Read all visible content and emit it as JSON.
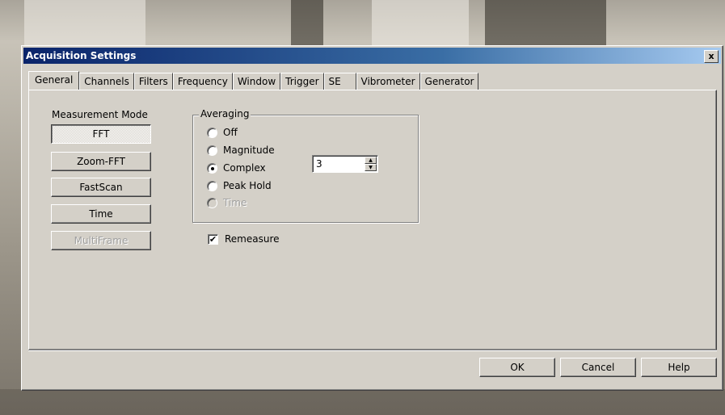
{
  "window": {
    "title": "Acquisition Settings",
    "close_label": "x"
  },
  "tabs": [
    {
      "label": "General",
      "active": true
    },
    {
      "label": "Channels"
    },
    {
      "label": "Filters"
    },
    {
      "label": "Frequency"
    },
    {
      "label": "Window"
    },
    {
      "label": "Trigger"
    },
    {
      "label": "SE"
    },
    {
      "label": "Vibrometer"
    },
    {
      "label": "Generator"
    }
  ],
  "measurement_mode": {
    "label": "Measurement Mode",
    "buttons": [
      {
        "label": "FFT",
        "state": "pressed"
      },
      {
        "label": "Zoom-FFT"
      },
      {
        "label": "FastScan"
      },
      {
        "label": "Time"
      },
      {
        "label": "MultiFrame",
        "state": "disabled"
      }
    ]
  },
  "averaging": {
    "title": "Averaging",
    "options": [
      {
        "label": "Off"
      },
      {
        "label": "Magnitude"
      },
      {
        "label": "Complex",
        "checked": true
      },
      {
        "label": "Peak Hold"
      },
      {
        "label": "Time",
        "disabled": true
      }
    ],
    "count": "3"
  },
  "remeasure": {
    "label": "Remeasure",
    "checked": true,
    "mark": "✔"
  },
  "footer": {
    "ok": "OK",
    "cancel": "Cancel",
    "help": "Help"
  },
  "spinner_arrows": {
    "up": "▲",
    "down": "▼"
  }
}
